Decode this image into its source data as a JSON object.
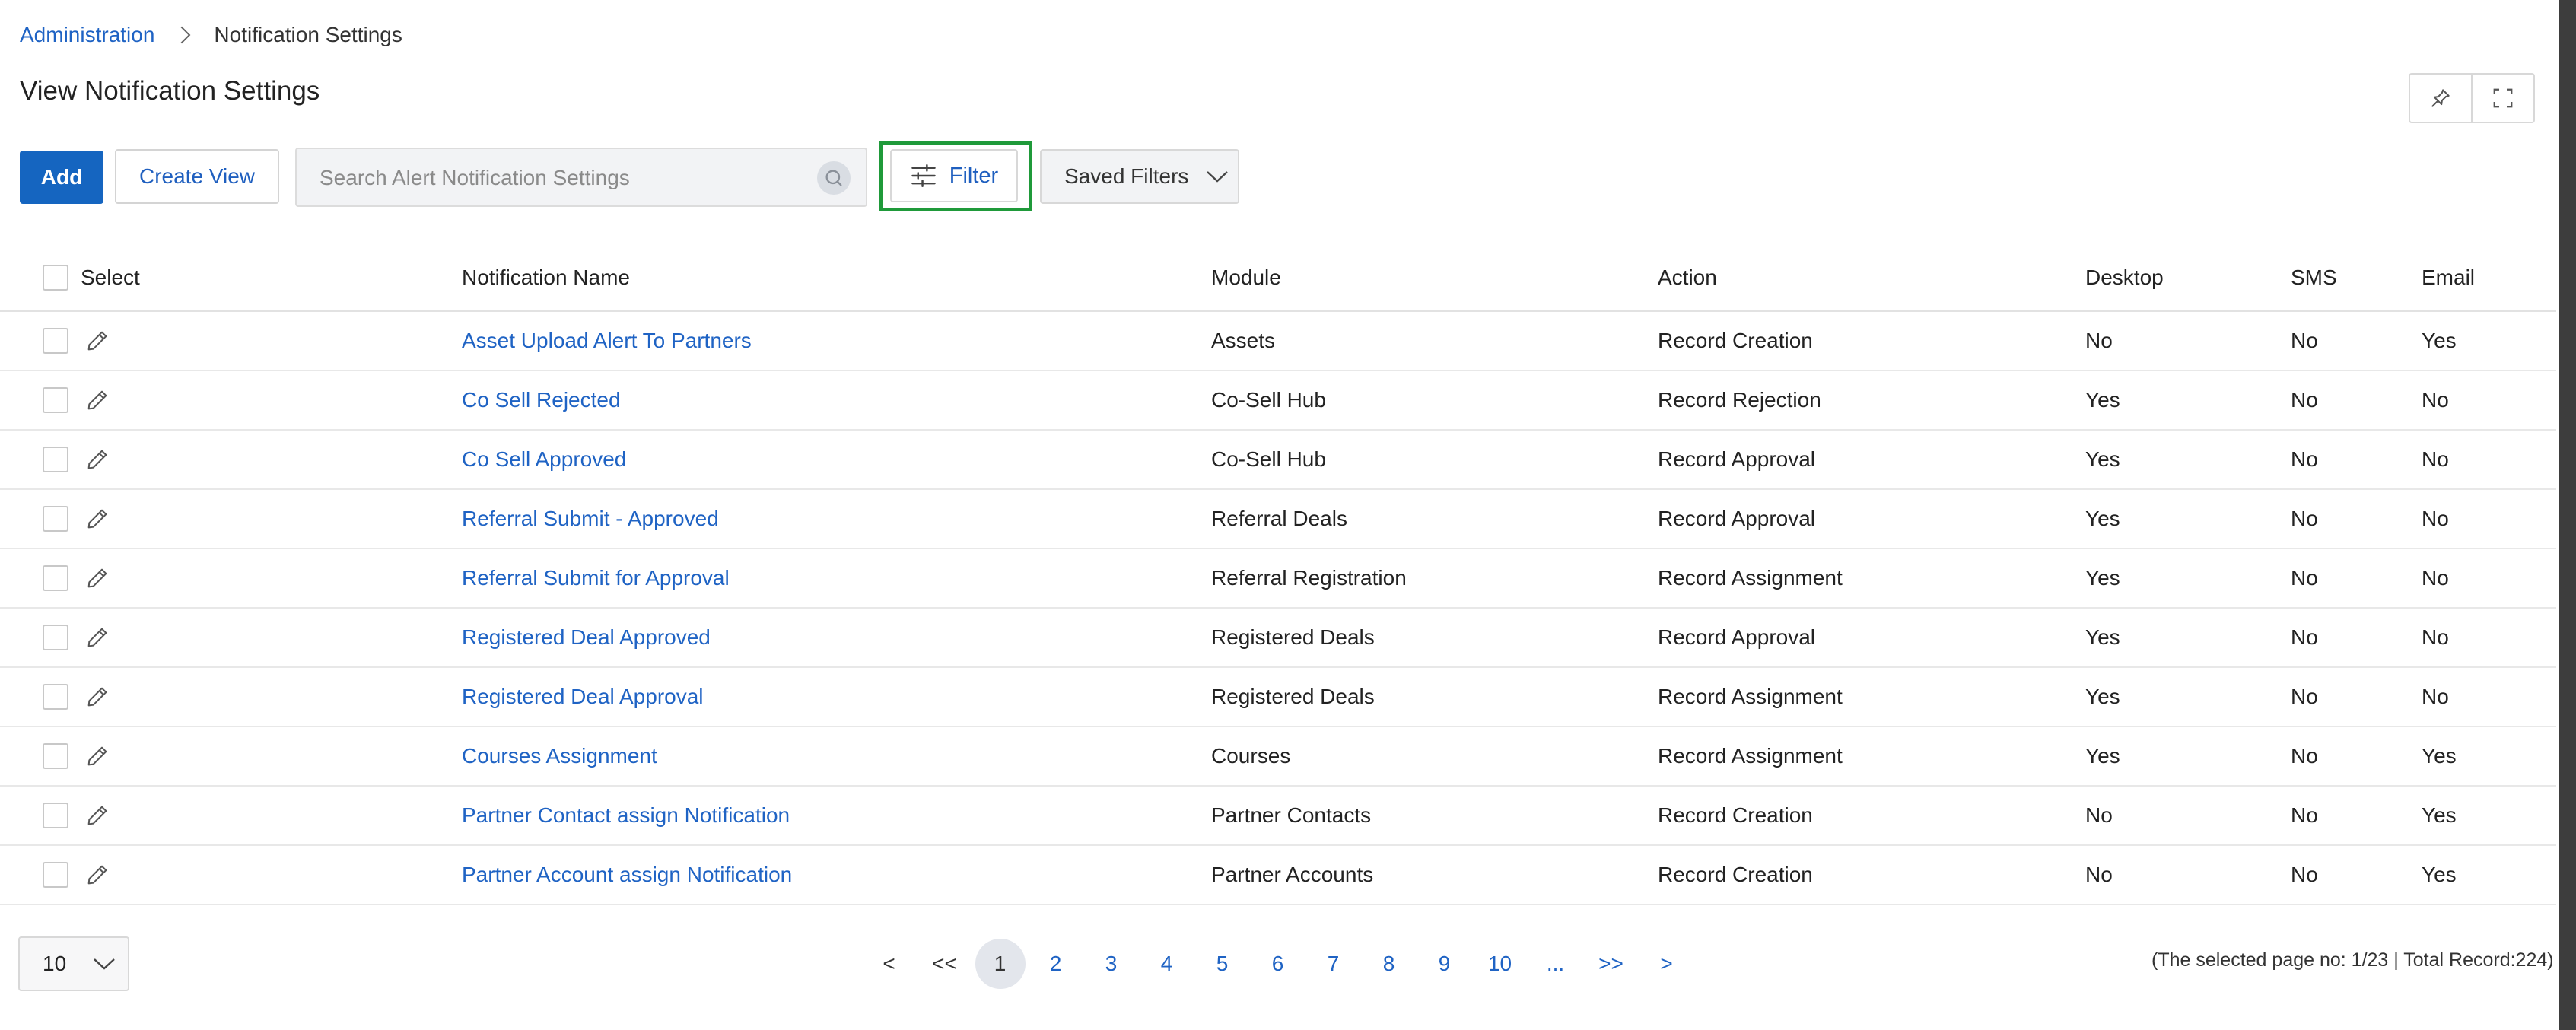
{
  "breadcrumb": {
    "parent": "Administration",
    "current": "Notification Settings"
  },
  "page_title": "View Notification Settings",
  "toolbar": {
    "add_label": "Add",
    "create_view_label": "Create View",
    "search_placeholder": "Search Alert Notification Settings",
    "filter_label": "Filter",
    "saved_filters_label": "Saved Filters"
  },
  "table": {
    "headers": {
      "select": "Select",
      "name": "Notification Name",
      "module": "Module",
      "action": "Action",
      "desktop": "Desktop",
      "sms": "SMS",
      "email": "Email"
    },
    "rows": [
      {
        "name": "Asset Upload Alert To Partners",
        "module": "Assets",
        "action": "Record Creation",
        "desktop": "No",
        "sms": "No",
        "email": "Yes"
      },
      {
        "name": "Co Sell Rejected",
        "module": "Co-Sell Hub",
        "action": "Record Rejection",
        "desktop": "Yes",
        "sms": "No",
        "email": "No"
      },
      {
        "name": "Co Sell Approved",
        "module": "Co-Sell Hub",
        "action": "Record Approval",
        "desktop": "Yes",
        "sms": "No",
        "email": "No"
      },
      {
        "name": "Referral Submit - Approved",
        "module": "Referral Deals",
        "action": "Record Approval",
        "desktop": "Yes",
        "sms": "No",
        "email": "No"
      },
      {
        "name": "Referral Submit for Approval",
        "module": "Referral Registration",
        "action": "Record Assignment",
        "desktop": "Yes",
        "sms": "No",
        "email": "No"
      },
      {
        "name": "Registered Deal Approved",
        "module": "Registered Deals",
        "action": "Record Approval",
        "desktop": "Yes",
        "sms": "No",
        "email": "No"
      },
      {
        "name": "Registered Deal Approval",
        "module": "Registered Deals",
        "action": "Record Assignment",
        "desktop": "Yes",
        "sms": "No",
        "email": "No"
      },
      {
        "name": "Courses Assignment",
        "module": "Courses",
        "action": "Record Assignment",
        "desktop": "Yes",
        "sms": "No",
        "email": "Yes"
      },
      {
        "name": "Partner Contact assign Notification",
        "module": "Partner Contacts",
        "action": "Record Creation",
        "desktop": "No",
        "sms": "No",
        "email": "Yes"
      },
      {
        "name": "Partner Account assign Notification",
        "module": "Partner Accounts",
        "action": "Record Creation",
        "desktop": "No",
        "sms": "No",
        "email": "Yes"
      }
    ]
  },
  "footer": {
    "page_size": "10",
    "pager": {
      "prev": "<",
      "first": "<<",
      "pages": [
        "1",
        "2",
        "3",
        "4",
        "5",
        "6",
        "7",
        "8",
        "9",
        "10"
      ],
      "active_page": "1",
      "ellipsis": "...",
      "last": ">>",
      "next": ">"
    },
    "info": "(The selected page no: 1/23 | Total Record:224)"
  },
  "colors": {
    "accent": "#1565c0",
    "link": "#1f63c4",
    "highlight": "#1f9a3a"
  },
  "icons": [
    "chevron-right-icon",
    "pin-icon",
    "fullscreen-icon",
    "search-icon",
    "sliders-icon",
    "chevron-down-icon",
    "pencil-icon"
  ]
}
